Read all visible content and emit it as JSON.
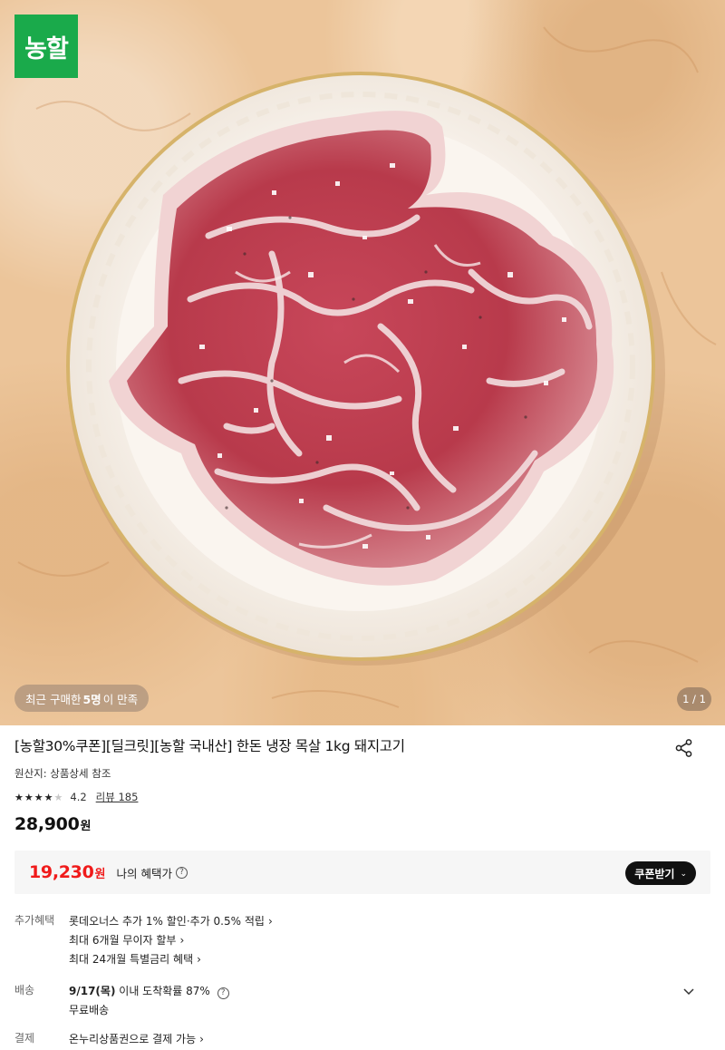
{
  "brand": {
    "logo_text": "농할",
    "color": "#1aaa4b"
  },
  "hero": {
    "recent_badge": {
      "prefix": "최근 구매한 ",
      "count": "5명",
      "suffix": "이 만족"
    },
    "page_indicator": "1 / 1"
  },
  "product": {
    "title": "[농할30%쿠폰][딜크릿][농할 국내산] 한돈 냉장 목살 1kg 돼지고기",
    "origin": "원산지: 상품상세 참조",
    "rating": {
      "value": "4.2",
      "stars_filled": 4,
      "stars_total": 5,
      "review_link": "리뷰 185"
    },
    "price": {
      "amount": "28,900",
      "unit": "원"
    },
    "benefit": {
      "amount": "19,230",
      "unit": "원",
      "label": "나의 혜택가",
      "coupon_button": "쿠폰받기",
      "accent_color": "#f01a1a"
    }
  },
  "details": {
    "benefits": {
      "label": "추가혜택",
      "items": [
        "롯데오너스 추가 1% 할인·추가 0.5% 적립",
        "최대 6개월 무이자 할부",
        "최대 24개월 특별금리 혜택"
      ]
    },
    "delivery": {
      "label": "배송",
      "date": "9/17(목)",
      "date_suffix": "이내 도착확률 87%",
      "fee": "무료배송"
    },
    "payment": {
      "label": "결제",
      "text": "온누리상품권으로 결제 가능"
    }
  },
  "icons": {
    "share": "share-icon",
    "help": "help-icon",
    "chevron_down": "chevron-down-icon",
    "chevron_right": "chevron-right-icon",
    "star": "star-icon"
  }
}
